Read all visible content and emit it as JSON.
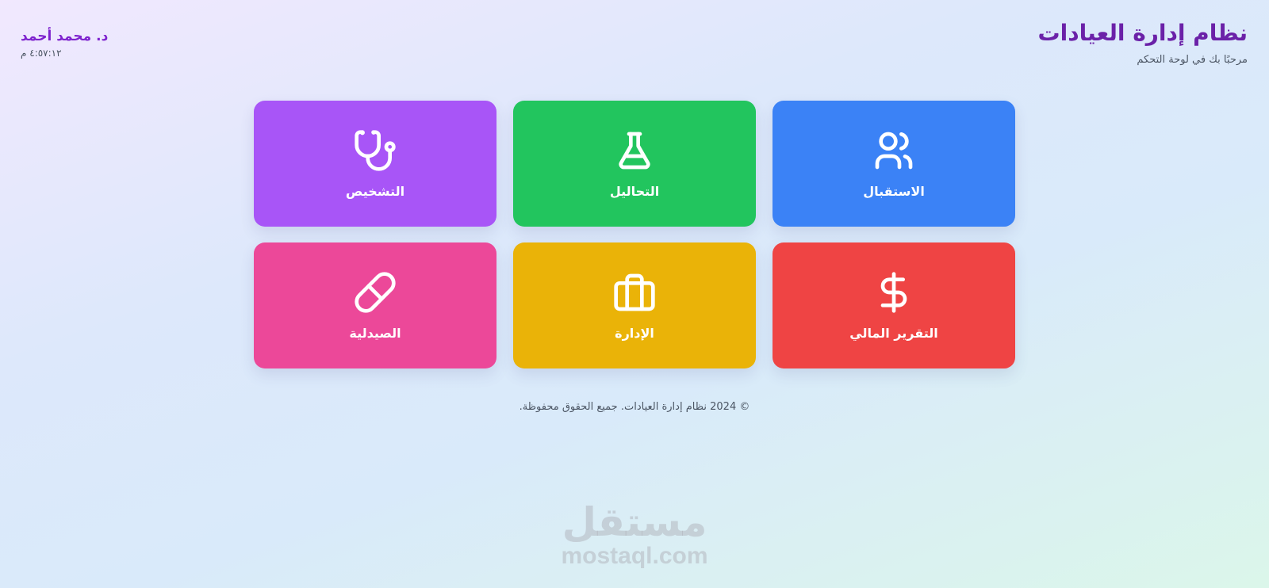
{
  "header": {
    "title": "نظام إدارة العيادات",
    "subtitle": "مرحبًا بك في لوحة التحكم",
    "user_name": "د. محمد أحمد",
    "time": "٤:٥٧:١٢ م"
  },
  "cards": [
    {
      "label": "الاستقبال",
      "icon": "users-icon",
      "color": "#3b82f6"
    },
    {
      "label": "التحاليل",
      "icon": "flask-icon",
      "color": "#22c55e"
    },
    {
      "label": "التشخيص",
      "icon": "stethoscope-icon",
      "color": "#a855f7"
    },
    {
      "label": "التقرير المالي",
      "icon": "dollar-icon",
      "color": "#ef4444"
    },
    {
      "label": "الإدارة",
      "icon": "briefcase-icon",
      "color": "#eab308"
    },
    {
      "label": "الصيدلية",
      "icon": "pill-icon",
      "color": "#ec4899"
    }
  ],
  "footer": {
    "text": "© 2024 نظام إدارة العيادات. جميع الحقوق محفوظة."
  },
  "watermark": {
    "arabic": "مستقل",
    "latin": "mostaql.com"
  }
}
